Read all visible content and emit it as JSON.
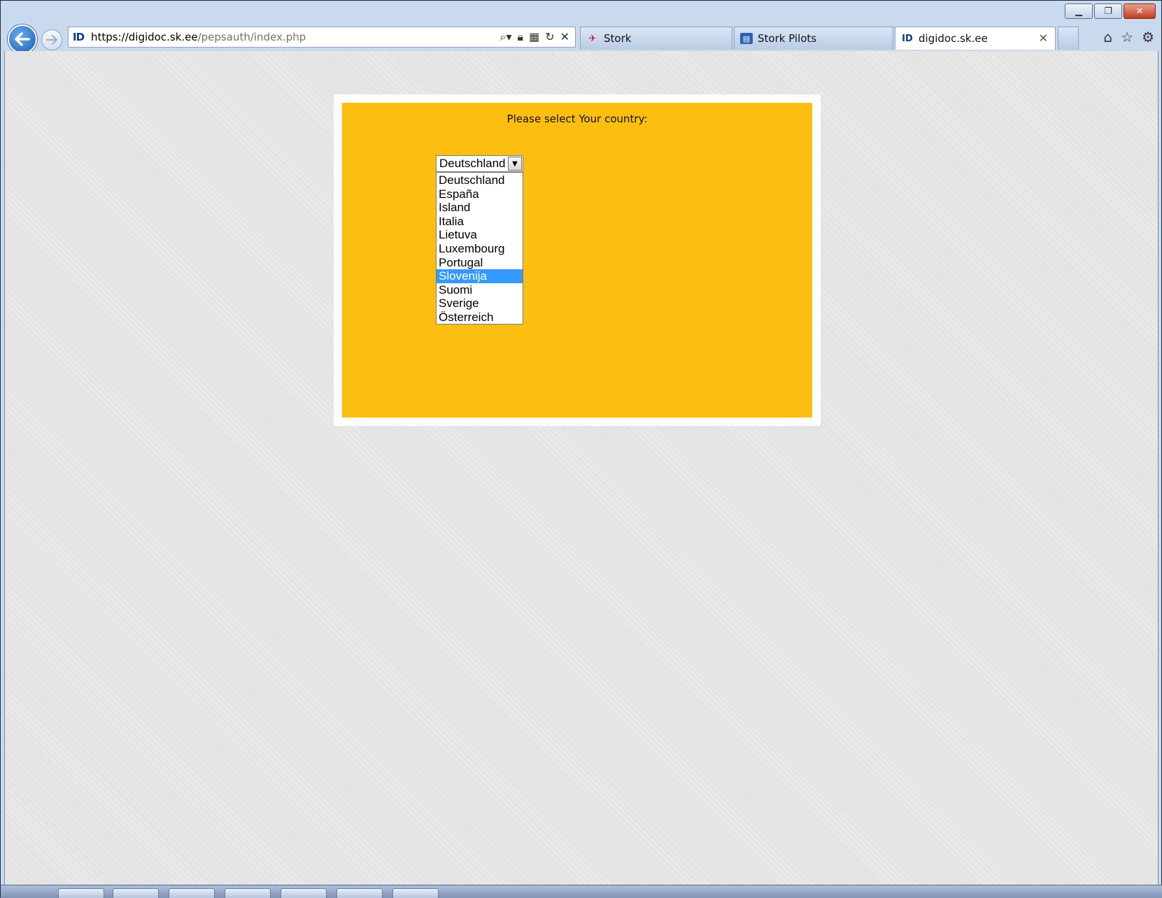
{
  "browser": {
    "address": {
      "site_badge": "ID",
      "url_prefix": "https://",
      "url_host": "digidoc.sk.ee",
      "url_path": "/pepsauth/index.php"
    },
    "tabs": [
      {
        "label": "Stork",
        "icon": "stork-favicon",
        "active": false
      },
      {
        "label": "Stork Pilots",
        "icon": "stork-pilots-favicon",
        "active": false
      },
      {
        "label": "digidoc.sk.ee",
        "icon": "id-favicon",
        "active": true
      }
    ],
    "icons": {
      "back": "back-arrow-icon",
      "forward": "forward-arrow-icon",
      "search": "search-icon",
      "lock": "lock-icon",
      "compat": "compatibility-icon",
      "refresh": "refresh-icon",
      "stop": "stop-icon",
      "home": "home-icon",
      "favorites": "star-icon",
      "tools": "gear-icon"
    }
  },
  "page": {
    "prompt": "Please select Your country:",
    "select": {
      "value": "Deutschland",
      "options": [
        "Deutschland",
        "España",
        "Island",
        "Italia",
        "Lietuva",
        "Luxembourg",
        "Portugal",
        "Slovenija",
        "Suomi",
        "Sverige",
        "Österreich"
      ],
      "highlighted": "Slovenija"
    }
  },
  "colors": {
    "panel": "#fdbe12",
    "highlight": "#3399ff"
  }
}
